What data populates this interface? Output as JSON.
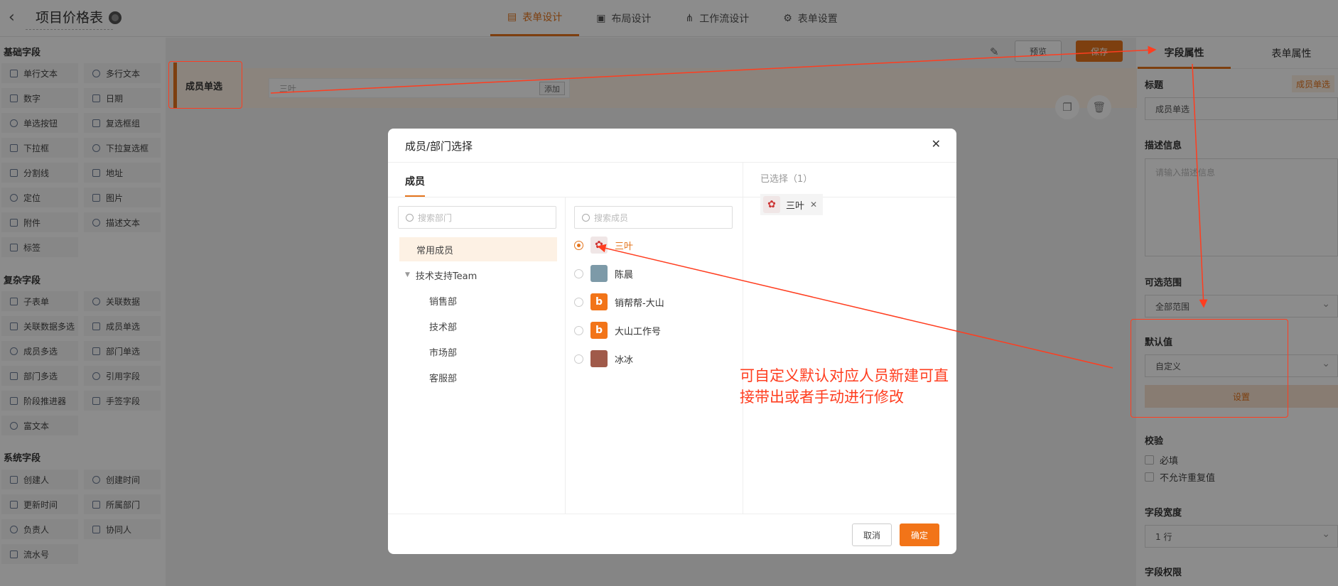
{
  "header": {
    "back_icon": "chevron-left-icon",
    "title": "项目价格表",
    "tabs": [
      {
        "label": "表单设计",
        "icon": "form-icon",
        "active": true
      },
      {
        "label": "布局设计",
        "icon": "layout-icon",
        "active": false
      },
      {
        "label": "工作流设计",
        "icon": "workflow-icon",
        "active": false
      },
      {
        "label": "表单设置",
        "icon": "gear-icon",
        "active": false
      }
    ]
  },
  "palette": {
    "groups": [
      {
        "title": "基础字段",
        "items": [
          "单行文本",
          "多行文本",
          "数字",
          "日期",
          "单选按钮",
          "复选框组",
          "下拉框",
          "下拉复选框",
          "分割线",
          "地址",
          "定位",
          "图片",
          "附件",
          "描述文本",
          "标签"
        ]
      },
      {
        "title": "复杂字段",
        "items": [
          "子表单",
          "关联数据",
          "关联数据多选",
          "成员单选",
          "成员多选",
          "部门单选",
          "部门多选",
          "引用字段",
          "阶段推进器",
          "手签字段",
          "富文本"
        ]
      },
      {
        "title": "系统字段",
        "items": [
          "创建人",
          "创建时间",
          "更新时间",
          "所属部门",
          "负责人",
          "协同人",
          "流水号"
        ]
      }
    ]
  },
  "canvas": {
    "preview_label": "预览",
    "save_label": "保存",
    "field_label": "成员单选",
    "field_value": "三叶",
    "add_label": "添加"
  },
  "right_panel": {
    "tabs": [
      "字段属性",
      "表单属性"
    ],
    "title_label": "标题",
    "title_tag": "成员单选",
    "title_value": "成员单选",
    "desc_label": "描述信息",
    "desc_placeholder": "请输入描述信息",
    "range_label": "可选范围",
    "range_value": "全部范围",
    "default_label": "默认值",
    "default_value": "自定义",
    "set_label": "设置",
    "validate_label": "校验",
    "validate_required": "必填",
    "validate_unique": "不允许重复值",
    "width_label": "字段宽度",
    "width_value": "1 行",
    "permission_label": "字段权限"
  },
  "modal": {
    "title": "成员/部门选择",
    "close_icon": "close-icon",
    "tab_label": "成员",
    "dept_search_placeholder": "搜索部门",
    "member_search_placeholder": "搜索成员",
    "departments": [
      {
        "label": "常用成员",
        "selected": true
      },
      {
        "label": "技术支持Team",
        "selected": false
      },
      {
        "label": "销售部",
        "selected": false
      },
      {
        "label": "技术部",
        "selected": false
      },
      {
        "label": "市场部",
        "selected": false
      },
      {
        "label": "客服部",
        "selected": false
      }
    ],
    "members": [
      {
        "name": "三叶",
        "checked": true,
        "avatar": "flower-avatar"
      },
      {
        "name": "陈晨",
        "checked": false,
        "avatar": "photo-avatar"
      },
      {
        "name": "销帮帮-大山",
        "checked": false,
        "avatar": "b-logo-avatar"
      },
      {
        "name": "大山工作号",
        "checked": false,
        "avatar": "b-logo-avatar"
      },
      {
        "name": "冰冰",
        "checked": false,
        "avatar": "photo-avatar"
      }
    ],
    "selected_title": "已选择（1）",
    "selected": [
      "三叶"
    ],
    "cancel_label": "取消",
    "ok_label": "确定"
  },
  "annotation": {
    "text": "可自定义默认对应人员新建可直接带出或者手动进行修改",
    "color": "#ff3d1f"
  },
  "colors": {
    "accent": "#e4741c",
    "overlay": "rgba(0,0,0,0.45)"
  }
}
